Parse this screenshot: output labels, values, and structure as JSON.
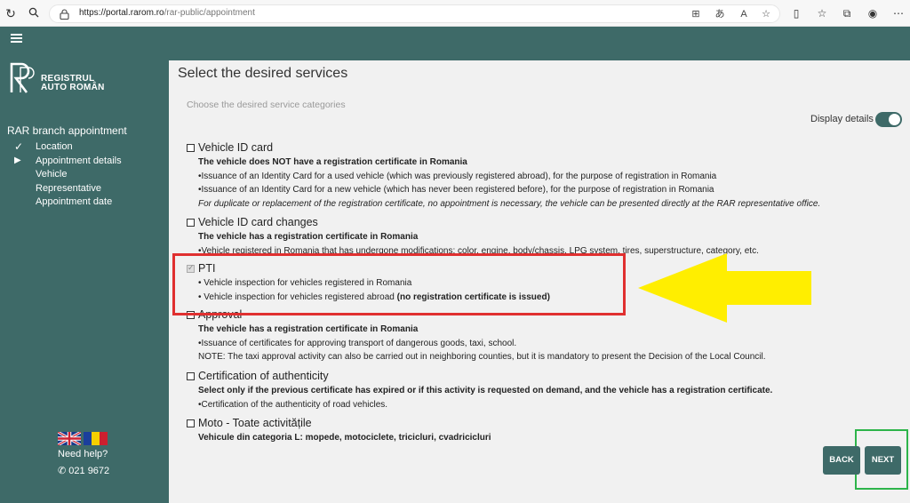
{
  "browser": {
    "url_host": "https://portal.rarom.ro",
    "url_path": "/rar-public/appointment"
  },
  "sidebar": {
    "logo_line1": "REGISTRUL",
    "logo_line2": "AUTO ROMÂN",
    "heading": "RAR branch appointment",
    "steps": [
      {
        "label": "Location",
        "state": "done"
      },
      {
        "label": "Appointment details",
        "state": "current"
      },
      {
        "label": "Vehicle",
        "state": "pending"
      },
      {
        "label": "Representative",
        "state": "pending"
      },
      {
        "label": "Appointment date",
        "state": "pending"
      }
    ],
    "help_text": "Need help?",
    "phone": "021 9672"
  },
  "main": {
    "title": "Select the desired services",
    "subtitle": "Choose the desired service categories",
    "display_details_label": "Display details",
    "display_details_on": true,
    "services": [
      {
        "title": "Vehicle ID card",
        "checked": false,
        "lines": [
          {
            "text": "The vehicle does NOT have a registration certificate in Romania",
            "style": "bold"
          },
          {
            "text": "•Issuance of an Identity Card for a used vehicle (which was previously registered abroad), for the purpose of registration in Romania",
            "style": "normal"
          },
          {
            "text": "•Issuance of an Identity Card for a new vehicle (which has never been registered before), for the purpose of registration in Romania",
            "style": "normal"
          },
          {
            "text": "For duplicate or replacement of the registration certificate, no appointment is necessary, the vehicle can be presented directly at the RAR representative office.",
            "style": "italic"
          }
        ]
      },
      {
        "title": "Vehicle ID card changes",
        "checked": false,
        "lines": [
          {
            "text": "The vehicle has a registration certificate in Romania",
            "style": "bold"
          },
          {
            "text": "•Vehicle registered in Romania that has undergone modifications: color, engine, body/chassis, LPG system, tires, superstructure, category, etc.",
            "style": "normal"
          }
        ]
      },
      {
        "title": "PTI",
        "checked": true,
        "lines": [
          {
            "text": "• Vehicle inspection for vehicles registered in Romania",
            "style": "normal"
          },
          {
            "text": "• Vehicle inspection for vehicles registered abroad ",
            "style": "normal",
            "bold_suffix": "(no registration certificate is issued)"
          }
        ]
      },
      {
        "title": "Approval",
        "checked": false,
        "lines": [
          {
            "text": "The vehicle has a registration certificate in Romania",
            "style": "bold"
          },
          {
            "text": "•Issuance of certificates for approving transport of dangerous goods, taxi, school.",
            "style": "normal"
          },
          {
            "text": "NOTE: The taxi approval activity can also be carried out in neighboring counties, but it is mandatory to present the Decision of the Local Council.",
            "style": "normal"
          }
        ]
      },
      {
        "title": "Certification of authenticity",
        "checked": false,
        "lines": [
          {
            "text": "Select only if the previous certificate has expired or if this activity is requested on demand, and the vehicle has a registration certificate.",
            "style": "bold"
          },
          {
            "text": "•Certification of the authenticity of road vehicles.",
            "style": "normal"
          }
        ]
      },
      {
        "title": "Moto - Toate activitățile",
        "checked": false,
        "lines": [
          {
            "text": "Vehicule din categoria L: mopede, motociclete, tricicluri, cvadricicluri",
            "style": "bold"
          }
        ]
      }
    ],
    "back_label": "BACK",
    "next_label": "NEXT"
  },
  "colors": {
    "teal": "#3e6a68",
    "annotation_red": "#e03030",
    "annotation_yellow": "#ffee00",
    "annotation_green": "#2db44a"
  }
}
